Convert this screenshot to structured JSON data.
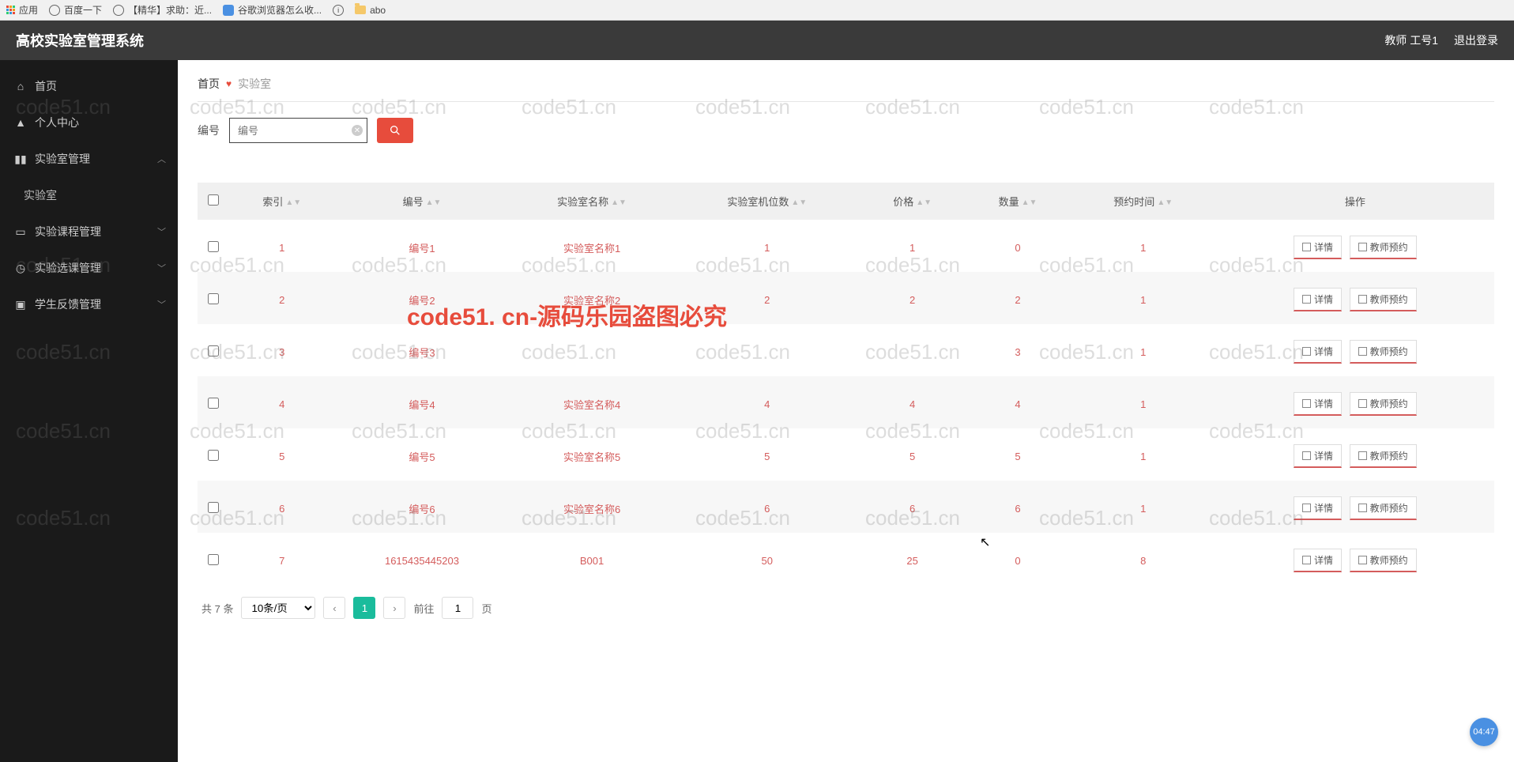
{
  "bookmarks": {
    "apps": "应用",
    "baidu": "百度一下",
    "jinghua": "【精华】求助：近...",
    "google": "谷歌浏览器怎么收...",
    "abo": "abo"
  },
  "header": {
    "title": "高校实验室管理系统",
    "user": "教师 工号1",
    "logout": "退出登录"
  },
  "sidebar": {
    "home": "首页",
    "personal": "个人中心",
    "lab_manage": "实验室管理",
    "lab": "实验室",
    "course_manage": "实验课程管理",
    "elective_manage": "实验选课管理",
    "feedback_manage": "学生反馈管理"
  },
  "breadcrumb": {
    "home": "首页",
    "current": "实验室"
  },
  "search": {
    "label": "编号",
    "placeholder": "编号"
  },
  "table": {
    "columns": {
      "index": "索引",
      "code": "编号",
      "name": "实验室名称",
      "seats": "实验室机位数",
      "price": "价格",
      "quantity": "数量",
      "reserve_time": "预约时间",
      "operation": "操作"
    },
    "buttons": {
      "detail": "详情",
      "teacher_reserve": "教师预约"
    },
    "rows": [
      {
        "index": "1",
        "code": "编号1",
        "name": "实验室名称1",
        "seats": "1",
        "price": "1",
        "quantity": "0",
        "reserve_time": "1"
      },
      {
        "index": "2",
        "code": "编号2",
        "name": "实验室名称2",
        "seats": "2",
        "price": "2",
        "quantity": "2",
        "reserve_time": "1"
      },
      {
        "index": "3",
        "code": "编号3",
        "name": "",
        "seats": "",
        "price": "",
        "quantity": "3",
        "reserve_time": "1"
      },
      {
        "index": "4",
        "code": "编号4",
        "name": "实验室名称4",
        "seats": "4",
        "price": "4",
        "quantity": "4",
        "reserve_time": "1"
      },
      {
        "index": "5",
        "code": "编号5",
        "name": "实验室名称5",
        "seats": "5",
        "price": "5",
        "quantity": "5",
        "reserve_time": "1"
      },
      {
        "index": "6",
        "code": "编号6",
        "name": "实验室名称6",
        "seats": "6",
        "price": "6",
        "quantity": "6",
        "reserve_time": "1"
      },
      {
        "index": "7",
        "code": "1615435445203",
        "name": "B001",
        "seats": "50",
        "price": "25",
        "quantity": "0",
        "reserve_time": "8"
      }
    ]
  },
  "pagination": {
    "total": "共 7 条",
    "page_size": "10条/页",
    "goto": "前往",
    "page_suffix": "页",
    "current": "1"
  },
  "watermark_big": "code51. cn-源码乐园盗图必究",
  "watermark_small": "code51.cn",
  "timer": "04:47"
}
